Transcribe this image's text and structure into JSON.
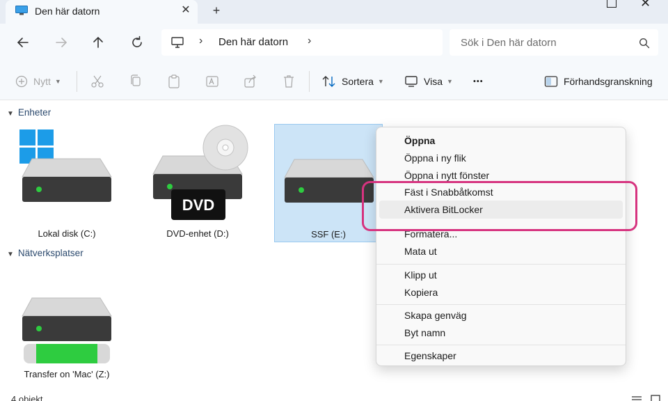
{
  "tab": {
    "title": "Den här datorn",
    "close_glyph": "✕",
    "add_glyph": "+"
  },
  "window": {
    "close_glyph": "✕"
  },
  "address": {
    "location": "Den här datorn",
    "separator": "›"
  },
  "search": {
    "placeholder": "Sök i Den här datorn"
  },
  "commandbar": {
    "new_label": "Nytt",
    "sort_label": "Sortera",
    "view_label": "Visa",
    "more_glyph": "•••",
    "preview_label": "Förhandsgranskning"
  },
  "sections": {
    "devices": "Enheter",
    "network": "Nätverksplatser"
  },
  "drives": [
    {
      "label": "Lokal disk (C:)"
    },
    {
      "label": "DVD-enhet (D:)",
      "badge": "DVD"
    },
    {
      "label": "SSF (E:)"
    },
    {
      "label": "Transfer on 'Mac' (Z:)"
    }
  ],
  "status": {
    "count_text": "4 objekt"
  },
  "context_menu": {
    "items": [
      {
        "label": "Öppna"
      },
      {
        "label": "Öppna i ny flik"
      },
      {
        "label": "Öppna i nytt fönster"
      },
      {
        "label": "Fäst i Snabbåtkomst"
      },
      {
        "label": "Aktivera BitLocker"
      },
      {
        "label": "Formatera..."
      },
      {
        "label": "Mata ut"
      },
      {
        "label": "Klipp ut"
      },
      {
        "label": "Kopiera"
      },
      {
        "label": "Skapa genväg"
      },
      {
        "label": "Byt namn"
      },
      {
        "label": "Egenskaper"
      }
    ]
  },
  "colors": {
    "accent": "#0067c0",
    "selection": "#cce4f7",
    "highlight_ring": "#d6337f",
    "led": "#2ecc40"
  }
}
